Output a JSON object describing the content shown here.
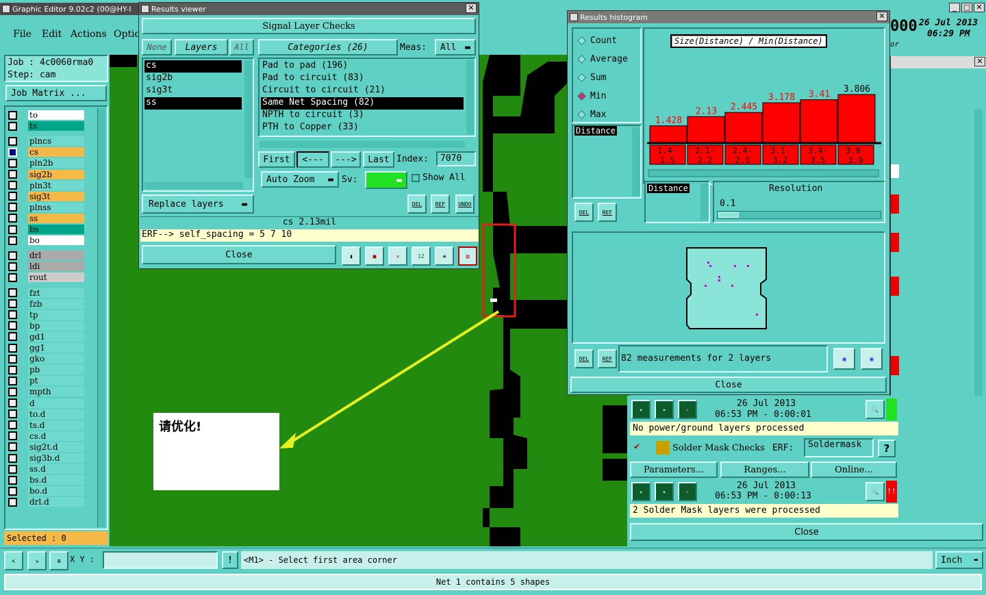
{
  "main_window": {
    "title": "Graphic Editor 9.02c2 (00@HY-I",
    "menu": [
      "File",
      "Edit",
      "Actions",
      "Optio"
    ]
  },
  "job": {
    "job_label": "Job : 4c0060rma0",
    "step_label": "Step: cam",
    "job_matrix": "Job Matrix ..."
  },
  "layers": [
    {
      "name": "to",
      "bg": "#ffffff"
    },
    {
      "name": "ts",
      "bg": "#00a58a"
    },
    {
      "name": "plncs",
      "bg": "#6ed9cc"
    },
    {
      "name": "cs",
      "bg": "#f5b948"
    },
    {
      "name": "pln2b",
      "bg": "#6ed9cc"
    },
    {
      "name": "sig2b",
      "bg": "#f5b948"
    },
    {
      "name": "pln3t",
      "bg": "#6ed9cc"
    },
    {
      "name": "sig3t",
      "bg": "#f5b948"
    },
    {
      "name": "plnss",
      "bg": "#6ed9cc"
    },
    {
      "name": "ss",
      "bg": "#f5b948"
    },
    {
      "name": "bs",
      "bg": "#00a58a"
    },
    {
      "name": "bo",
      "bg": "#ffffff"
    },
    {
      "name": "drl",
      "bg": "#aaaaaa"
    },
    {
      "name": "ldi",
      "bg": "#aaaaaa"
    },
    {
      "name": "rout",
      "bg": "#cccccc"
    },
    {
      "name": "fzt",
      "bg": "#6ed9cc"
    },
    {
      "name": "fzb",
      "bg": "#6ed9cc"
    },
    {
      "name": "tp",
      "bg": "#6ed9cc"
    },
    {
      "name": "bp",
      "bg": "#6ed9cc"
    },
    {
      "name": "gd1",
      "bg": "#6ed9cc"
    },
    {
      "name": "gg1",
      "bg": "#6ed9cc"
    },
    {
      "name": "gko",
      "bg": "#6ed9cc"
    },
    {
      "name": "pb",
      "bg": "#6ed9cc"
    },
    {
      "name": "pt",
      "bg": "#6ed9cc"
    },
    {
      "name": "mpth",
      "bg": "#6ed9cc"
    },
    {
      "name": "d",
      "bg": "#6ed9cc"
    },
    {
      "name": "to.d",
      "bg": "#6ed9cc"
    },
    {
      "name": "ts.d",
      "bg": "#6ed9cc"
    },
    {
      "name": "cs.d",
      "bg": "#6ed9cc"
    },
    {
      "name": "sig2t.d",
      "bg": "#6ed9cc"
    },
    {
      "name": "sig3b.d",
      "bg": "#6ed9cc"
    },
    {
      "name": "ss.d",
      "bg": "#6ed9cc"
    },
    {
      "name": "bs.d",
      "bg": "#6ed9cc"
    },
    {
      "name": "bo.d",
      "bg": "#6ed9cc"
    },
    {
      "name": "drl.d",
      "bg": "#6ed9cc"
    }
  ],
  "selected": "Selected : 0",
  "results_viewer": {
    "title": "Results viewer",
    "heading": "Signal Layer Checks",
    "none": "None",
    "layers_label": "Layers",
    "all": "All",
    "layer_list": [
      "cs",
      "sig2b",
      "sig3t",
      "ss"
    ],
    "categories_label": "Categories (26)",
    "meas_label": "Meas:",
    "meas_value": "All",
    "categories": [
      "Pad to pad (196)",
      "Pad to circuit (83)",
      "Circuit to circuit (21)",
      "Same Net Spacing (82)",
      "NPTH to circuit (3)",
      "PTH to Copper (33)"
    ],
    "first": "First",
    "prev": "<---",
    "next": "--->",
    "last": "Last",
    "index_label": "Index:",
    "index_value": "7070",
    "auto_zoom": "Auto Zoom",
    "sv": "Sv:",
    "show_all": "Show All",
    "replace_layers": "Replace layers",
    "status": "cs 2.13mil",
    "erf": "ERF--> self_spacing = 5 7 10",
    "close": "Close",
    "del": "DEL",
    "ref": "REF",
    "undo": "UNDO"
  },
  "histogram": {
    "title": "Results histogram",
    "options": [
      "Count",
      "Average",
      "Sum",
      "Min",
      "Max"
    ],
    "selected_option": "Min",
    "chart_title": "Size(Distance) / Min(Distance)",
    "x_label": "Distance",
    "resolution_label": "Resolution",
    "resolution_value": "0.1",
    "summary": "82 measurements for 2 layers",
    "close": "Close",
    "del": "DEL",
    "ref": "REF"
  },
  "chart_data": {
    "type": "bar",
    "title": "Size(Distance) / Min(Distance)",
    "categories": [
      "1.4-1.5",
      "2.1-2.2",
      "2.4-2.5",
      "3.1-3.2",
      "3.4-3.5",
      "3.8-3.9"
    ],
    "values": [
      1.428,
      2.13,
      2.445,
      3.178,
      3.41,
      3.806
    ],
    "value_labels": [
      "1.428",
      "2.13",
      "2.445",
      "3.178",
      "3.41",
      "3.806"
    ],
    "value_color": "#ff0000"
  },
  "checks_panel": {
    "date1": "26 Jul 2013",
    "time1": "06:53 PM - 0:00:01",
    "msg1": "No power/ground layers processed",
    "solder_title": "Solder Mask Checks",
    "erf": "ERF:",
    "erf_value": "Soldermask",
    "help": "?",
    "parameters": "Parameters...",
    "ranges": "Ranges...",
    "online": "Online...",
    "date2": "26 Jul 2013",
    "time2": "06:53 PM - 0:00:13",
    "msg2": "2 Solder Mask layers were processed",
    "close": "Close"
  },
  "top_right": {
    "num": "000",
    "date": "26 Jul 2013",
    "time": "06:29 PM",
    "extra": "or"
  },
  "annotation": {
    "text": "请优化!"
  },
  "bottom": {
    "xy_label": "X Y :",
    "prompt": "<M1> - Select first area corner",
    "unit": "Inch",
    "status": "Net 1 contains 5 shapes",
    "bang": "!"
  }
}
